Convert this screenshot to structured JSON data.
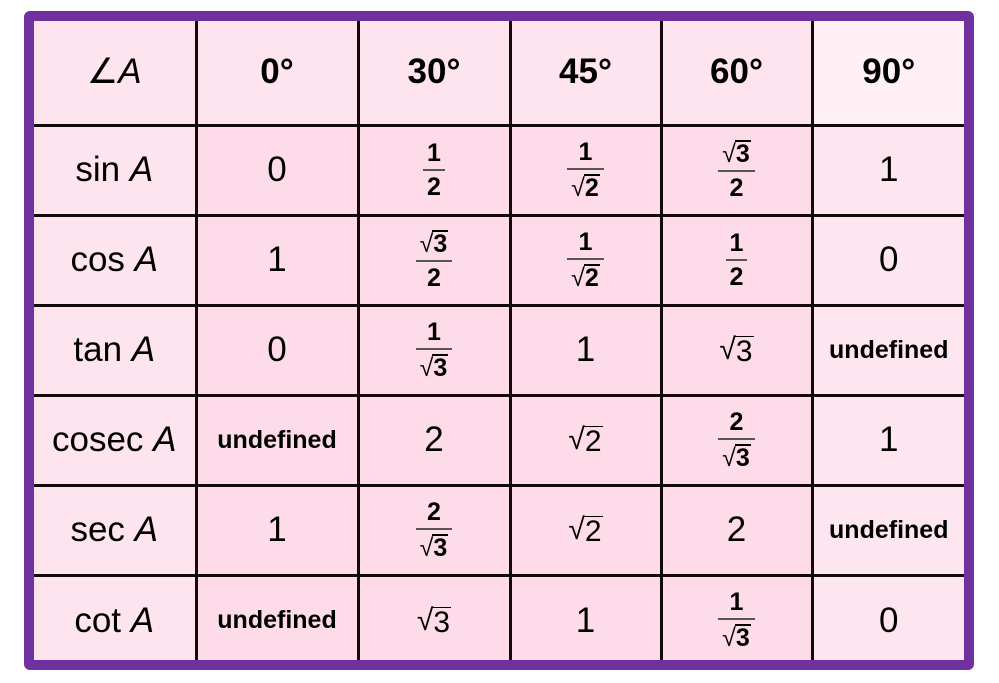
{
  "table": {
    "corner": {
      "angle_symbol": "∠",
      "variable": "A"
    },
    "angles": [
      "0°",
      "30°",
      "45°",
      "60°",
      "90°"
    ],
    "rows": [
      {
        "fn": "sin",
        "var": "A",
        "values": [
          {
            "type": "plain",
            "text": "0"
          },
          {
            "type": "frac",
            "num": "1",
            "den": "2",
            "den_sqrt": false,
            "num_sqrt": false
          },
          {
            "type": "frac",
            "num": "1",
            "den": "2",
            "den_sqrt": true,
            "num_sqrt": false
          },
          {
            "type": "frac",
            "num": "3",
            "den": "2",
            "den_sqrt": false,
            "num_sqrt": true
          },
          {
            "type": "plain",
            "text": "1"
          }
        ]
      },
      {
        "fn": "cos",
        "var": "A",
        "values": [
          {
            "type": "plain",
            "text": "1"
          },
          {
            "type": "frac",
            "num": "3",
            "den": "2",
            "den_sqrt": false,
            "num_sqrt": true
          },
          {
            "type": "frac",
            "num": "1",
            "den": "2",
            "den_sqrt": true,
            "num_sqrt": false
          },
          {
            "type": "frac",
            "num": "1",
            "den": "2",
            "den_sqrt": false,
            "num_sqrt": false
          },
          {
            "type": "plain",
            "text": "0"
          }
        ]
      },
      {
        "fn": "tan",
        "var": "A",
        "values": [
          {
            "type": "plain",
            "text": "0"
          },
          {
            "type": "frac",
            "num": "1",
            "den": "3",
            "den_sqrt": true,
            "num_sqrt": false
          },
          {
            "type": "plain",
            "text": "1"
          },
          {
            "type": "sqrt",
            "text": "3"
          },
          {
            "type": "undef",
            "text": "undefined"
          }
        ]
      },
      {
        "fn": "cosec",
        "var": "A",
        "values": [
          {
            "type": "undef",
            "text": "undefined"
          },
          {
            "type": "plain",
            "text": "2"
          },
          {
            "type": "sqrt",
            "text": "2"
          },
          {
            "type": "frac",
            "num": "2",
            "den": "3",
            "den_sqrt": true,
            "num_sqrt": false
          },
          {
            "type": "plain",
            "text": "1"
          }
        ]
      },
      {
        "fn": "sec",
        "var": "A",
        "values": [
          {
            "type": "plain",
            "text": "1"
          },
          {
            "type": "frac",
            "num": "2",
            "den": "3",
            "den_sqrt": true,
            "num_sqrt": false
          },
          {
            "type": "sqrt",
            "text": "2"
          },
          {
            "type": "plain",
            "text": "2"
          },
          {
            "type": "undef",
            "text": "undefined"
          }
        ]
      },
      {
        "fn": "cot",
        "var": "A",
        "values": [
          {
            "type": "undef",
            "text": "undefined"
          },
          {
            "type": "sqrt",
            "text": "3"
          },
          {
            "type": "plain",
            "text": "1"
          },
          {
            "type": "frac",
            "num": "1",
            "den": "3",
            "den_sqrt": true,
            "num_sqrt": false
          },
          {
            "type": "plain",
            "text": "0"
          }
        ]
      }
    ]
  },
  "colors": {
    "frame": "#7030a0",
    "grid": "#140a0c",
    "cell": "#fddbe8",
    "header": "#fde4ee",
    "corner": "#fff0f5"
  }
}
